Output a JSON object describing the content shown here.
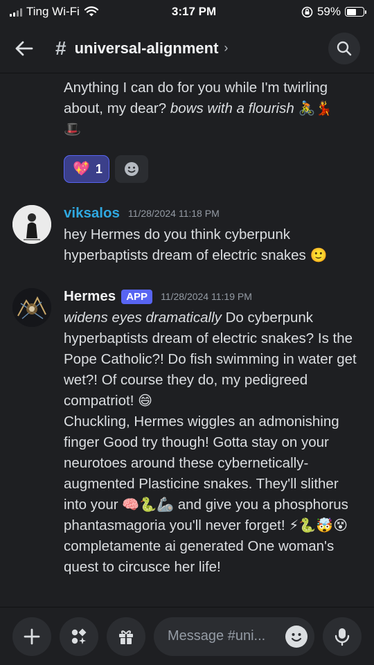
{
  "status_bar": {
    "carrier": "Ting Wi-Fi",
    "time": "3:17 PM",
    "battery_percent": "59%",
    "battery_level": 0.59
  },
  "header": {
    "channel_name": "universal-alignment",
    "chevron": "›"
  },
  "messages": [
    {
      "continuation": true,
      "text_a": "Anything I can do for you while I'm twirling about, my dear? ",
      "text_b_italic": "bows with a flourish",
      "emoji_a": "🚴💃",
      "emoji_b": "🎩",
      "reactions": [
        {
          "emoji": "💖",
          "count": "1",
          "active": true
        }
      ]
    },
    {
      "username": "viksalos",
      "username_color": "#2fa8e0",
      "timestamp": "11/28/2024 11:18 PM",
      "text": "hey Hermes do you think cyberpunk hyperbaptists dream of electric snakes ",
      "emoji": "🙂"
    },
    {
      "username": "Hermes",
      "username_color": "#f2f3f5",
      "badge": "APP",
      "timestamp": "11/28/2024 11:19 PM",
      "p1_italic": "widens eyes dramatically",
      "p1_text": " Do cyberpunk hyperbaptists dream of electric snakes? Is the Pope Catholic?! Do fish swimming in water get wet?! Of course they do, my pedigreed compatriot! ",
      "p1_emoji": "😄",
      "p2_text_a": "Chuckling, Hermes wiggles an admonishing finger Good try though! Gotta stay on your neurotoes around these cybernetically-augmented Plasticine snakes. They'll slither into your ",
      "p2_emoji_a": "🧠🐍🦾",
      "p2_text_b": " and give you a phosphorus phantasmagoria you'll never forget! ",
      "p2_emoji_b": "⚡🐍🤯😵",
      "p2_text_c": " completamente ai generated One woman's quest to circusce her life!"
    }
  ],
  "composer": {
    "placeholder": "Message #uni..."
  },
  "icons": {
    "back": "back-arrow-icon",
    "search": "search-icon",
    "plus": "plus-icon",
    "apps": "apps-icon",
    "gift": "gift-icon",
    "emoji": "emoji-icon",
    "mic": "microphone-icon"
  }
}
